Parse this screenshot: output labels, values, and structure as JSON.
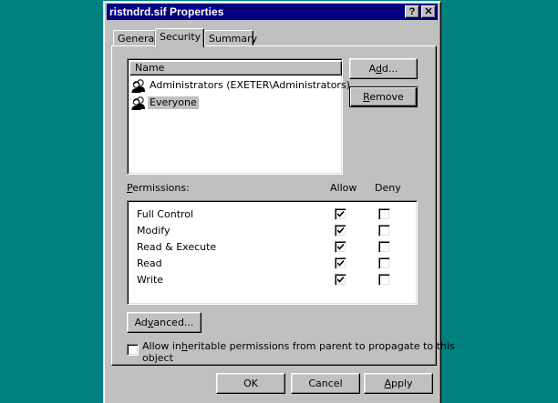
{
  "window": {
    "title": "ristndrd.sif Properties",
    "help_glyph": "?",
    "close_glyph": "✕"
  },
  "tabs": [
    {
      "label": "General",
      "active": false
    },
    {
      "label": "Security",
      "active": true
    },
    {
      "label": "Summary",
      "active": false
    }
  ],
  "users": {
    "column_header": "Name",
    "items": [
      {
        "label": "Administrators (EXETER\\Administrators)",
        "icon": "user-group-icon",
        "selected": false
      },
      {
        "label": "Everyone",
        "icon": "user-group-icon",
        "selected": true
      }
    ],
    "add_button": {
      "pre": "A",
      "key": "d",
      "post": "d..."
    },
    "remove_button": {
      "pre": "",
      "key": "R",
      "post": "emove"
    }
  },
  "permissions": {
    "label_pre": "",
    "label_key": "P",
    "label_post": "ermissions:",
    "allow_header": "Allow",
    "deny_header": "Deny",
    "items": [
      {
        "label": "Full Control",
        "allow": true,
        "deny": false
      },
      {
        "label": "Modify",
        "allow": true,
        "deny": false
      },
      {
        "label": "Read & Execute",
        "allow": true,
        "deny": false
      },
      {
        "label": "Read",
        "allow": true,
        "deny": false
      },
      {
        "label": "Write",
        "allow": true,
        "deny": false
      }
    ]
  },
  "advanced_button": {
    "pre": "Ad",
    "key": "v",
    "post": "anced..."
  },
  "inherit": {
    "checked": false,
    "line1_pre": "Allow in",
    "line1_key": "h",
    "line1_post": "eritable permissions from parent to propagate to this",
    "line2": "object"
  },
  "footer": {
    "ok": "OK",
    "cancel": "Cancel",
    "apply_key": "A",
    "apply_post": "pply"
  },
  "colors": {
    "desktop": "#008080",
    "titlebar": "#000080",
    "face": "#c0c0c0"
  }
}
